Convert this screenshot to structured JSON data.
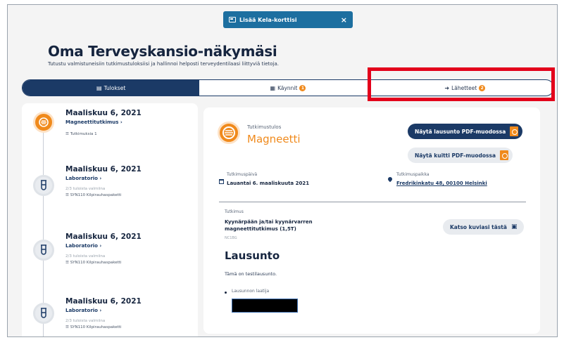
{
  "banner": {
    "label": "Lisää Kela-korttisi",
    "close": "×"
  },
  "header": {
    "title": "Oma Terveyskansio-näkymäsi",
    "subtitle": "Tutustu valmistuneisiin tutkimustuloksiisi ja hallinnoi helposti terveydentilaasi liittyviä tietoja."
  },
  "tabs": [
    {
      "label": "Tulokset",
      "icon": "results-icon",
      "badge": ""
    },
    {
      "label": "Käynnit",
      "icon": "calendar-icon",
      "badge": "1"
    },
    {
      "label": "Lähetteet",
      "icon": "referral-icon",
      "badge": "2"
    }
  ],
  "timeline": [
    {
      "date": "Maaliskuu 6, 2021",
      "category": "Magneettitutkimus ›",
      "small": "",
      "meta": "Tutkimuksia 1",
      "icon": "magnet-icon"
    },
    {
      "date": "Maaliskuu 6, 2021",
      "category": "Laboratorio ›",
      "small": "2/3 tuloista valmiina",
      "meta": "SYN110 Kilpirauhaspaketti",
      "icon": "test-tube-icon"
    },
    {
      "date": "Maaliskuu 6, 2021",
      "category": "Laboratorio ›",
      "small": "2/3 tuloista valmiina",
      "meta": "SYN110 Kilpirauhaspaketti",
      "icon": "test-tube-icon"
    },
    {
      "date": "Maaliskuu 6, 2021",
      "category": "Laboratorio ›",
      "small": "2/3 tuloista valmiina",
      "meta": "SYN110 Kilpirauhaspaketti",
      "icon": "test-tube-icon"
    }
  ],
  "detail": {
    "type_label": "Tutkimustulos",
    "type_value": "Magneetti",
    "btn_statement_pdf": "Näytä lausunto PDF-muodossa",
    "btn_receipt_pdf": "Näytä kuitti PDF-muodossa",
    "date_label": "Tutkimuspäivä",
    "date_value": "Lauantai 6. maaliskuuta 2021",
    "place_label": "Tutkimuspaikka",
    "place_value": "Fredrikinkatu 48, 00100 Helsinki",
    "study_label": "Tutkimus",
    "study_value": "Kyynärpään ja/tai kyynärvarren magneettitutkimus (1,5T)",
    "study_code": "NC1BG",
    "btn_images": "Katso kuviasi tästä",
    "statement_heading": "Lausunto",
    "statement_text": "Tämä on testilausunto.",
    "author_label": "Lausunnon laatija"
  },
  "colors": {
    "accent": "#f08a1c",
    "primary": "#1b3a66",
    "highlight": "#e3001b"
  }
}
